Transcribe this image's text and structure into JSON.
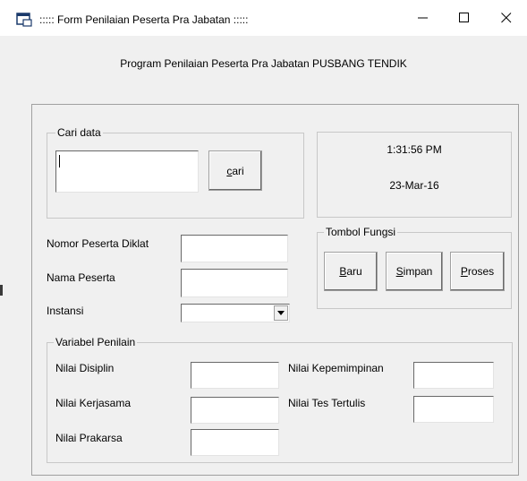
{
  "window": {
    "title": "::::: Form Penilaian Peserta Pra Jabatan :::::",
    "app_icon": "form-window-icon",
    "controls": [
      "minimize-icon",
      "maximize-icon",
      "close-icon"
    ]
  },
  "subtitle": "Program Penilaian Peserta Pra Jabatan PUSBANG TENDIK",
  "search": {
    "legend": "Cari data",
    "value": "",
    "button_mnemonic": "c",
    "button_rest": "ari"
  },
  "clock": {
    "time": "1:31:56 PM",
    "date": "23-Mar-16"
  },
  "fields": {
    "nomor_label": "Nomor Peserta Diklat",
    "nama_label": "Nama Peserta",
    "instansi_label": "Instansi",
    "nomor_value": "",
    "nama_value": "",
    "instansi_value": ""
  },
  "tombol": {
    "legend": "Tombol Fungsi",
    "baru_mn": "B",
    "baru_rest": "aru",
    "simpan_mn": "S",
    "simpan_rest": "impan",
    "proses_mn": "P",
    "proses_rest": "roses"
  },
  "variabel": {
    "legend": "Variabel Penilain",
    "disiplin": "Nilai Disiplin",
    "kerjasama": "Nilai Kerjasama",
    "prakarsa": "Nilai Prakarsa",
    "kepemimpinan": "Nilai Kepemimpinan",
    "tes_tertulis": "Nilai Tes Tertulis"
  }
}
